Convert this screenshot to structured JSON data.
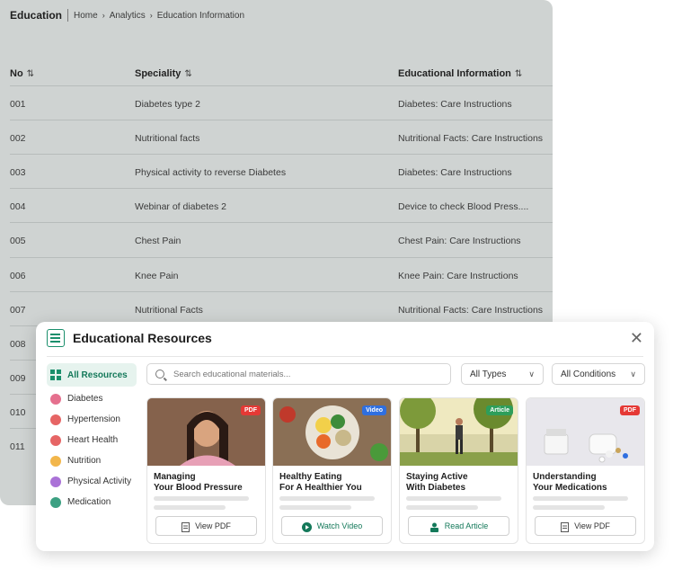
{
  "header": {
    "title": "Education",
    "breadcrumb": [
      "Home",
      "Analytics",
      "Education Information"
    ]
  },
  "table": {
    "columns": [
      "No",
      "Speciality",
      "Educational Information"
    ],
    "rows": [
      [
        "001",
        "Diabetes type 2",
        "Diabetes: Care Instructions"
      ],
      [
        "002",
        "Nutritional facts",
        "Nutritional Facts: Care Instructions"
      ],
      [
        "003",
        "Physical activity to reverse Diabetes",
        "Diabetes: Care Instructions"
      ],
      [
        "004",
        "Webinar of diabetes 2",
        "Device to check Blood Press...."
      ],
      [
        "005",
        "Chest Pain",
        "Chest Pain: Care Instructions"
      ],
      [
        "006",
        "Knee Pain",
        "Knee Pain: Care Instructions"
      ],
      [
        "007",
        "Nutritional Facts",
        "Nutritional Facts: Care Instructions"
      ],
      [
        "008",
        "",
        ""
      ],
      [
        "009",
        "",
        ""
      ],
      [
        "010",
        "",
        ""
      ],
      [
        "011",
        "",
        ""
      ]
    ]
  },
  "modal": {
    "title": "Educational Resources",
    "close_icon": "close-icon",
    "sidebar": [
      {
        "label": "All Resources",
        "icon": "grid-icon",
        "color": "#1a8f6c"
      },
      {
        "label": "Diabetes",
        "icon": "drop-icon",
        "color": "#e0577a"
      },
      {
        "label": "Hypertension",
        "icon": "heart-monitor-icon",
        "color": "#e24a4a"
      },
      {
        "label": "Heart Health",
        "icon": "heart-icon",
        "color": "#e24a4a"
      },
      {
        "label": "Nutrition",
        "icon": "nutrition-icon",
        "color": "#f0a92b"
      },
      {
        "label": "Physical Activity",
        "icon": "run-icon",
        "color": "#9b59d0"
      },
      {
        "label": "Medication",
        "icon": "medication-icon",
        "color": "#1a8f6c"
      }
    ],
    "search_placeholder": "Search educational materials...",
    "type_filter": "All Types",
    "condition_filter": "All Conditions",
    "cards": [
      {
        "title_line1": "Managing",
        "title_line2": "Your Blood Pressure",
        "badge": "PDF",
        "badge_color": "#e53935",
        "button": "View PDF",
        "button_icon": "pdf-icon"
      },
      {
        "title_line1": "Healthy Eating",
        "title_line2": "For A Healthier You",
        "badge": "Video",
        "badge_color": "#2f6fe0",
        "button": "Watch Video",
        "button_icon": "play-icon"
      },
      {
        "title_line1": "Staying Active",
        "title_line2": "With Diabetes",
        "badge": "Article",
        "badge_color": "#2e9e5b",
        "button": "Read Article",
        "button_icon": "article-icon"
      },
      {
        "title_line1": "Understanding",
        "title_line2": "Your Medications",
        "badge": "PDF",
        "badge_color": "#e53935",
        "button": "View PDF",
        "button_icon": "pdf-icon"
      }
    ]
  }
}
